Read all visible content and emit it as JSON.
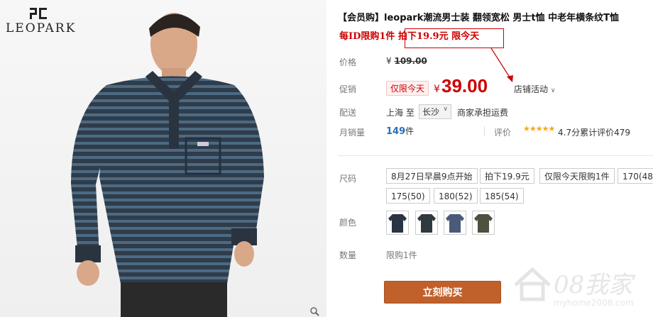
{
  "brand": {
    "logo_text": "LEOPARK"
  },
  "product": {
    "title": "【会员购】leopark潮流男士装 翻领宽松 男士t恤 中老年横条纹T恤",
    "promo_line": "每ID限购1件 拍下19.9元 限今天"
  },
  "price": {
    "label": "价格",
    "currency": "¥",
    "original": "109.00"
  },
  "promotion": {
    "label": "促销",
    "badge": "仅限今天",
    "currency": "¥",
    "sale_price": "39.00",
    "store_activity": "店铺活动"
  },
  "shipping": {
    "label": "配送",
    "from": "上海 至",
    "city": "长沙",
    "fee": "商家承担运费"
  },
  "sales": {
    "label": "月销量",
    "count": "149",
    "unit": "件",
    "review_label": "评价",
    "stars": "★★★★★",
    "score": "4.7分",
    "review_text": "累计评价479"
  },
  "size": {
    "label": "尺码",
    "options": [
      "8月27日早晨9点开始",
      "拍下19.9元",
      "仅限今天限购1件",
      "170(48",
      "175(50)",
      "180(52)",
      "185(54)"
    ]
  },
  "color": {
    "label": "颜色",
    "swatch_colors": [
      "#2b3445",
      "#2f3a3f",
      "#4a5a78",
      "#4c5140"
    ]
  },
  "quantity": {
    "label": "数量",
    "limit": "限购1件"
  },
  "buy_button": "立刻购买",
  "watermark": {
    "text": "08我家",
    "url": "myhome2008.com"
  },
  "colors": {
    "accent_red": "#cc0000",
    "buy_button": "#c0612b",
    "link_blue": "#2a6fb7",
    "star": "#f5a623"
  }
}
